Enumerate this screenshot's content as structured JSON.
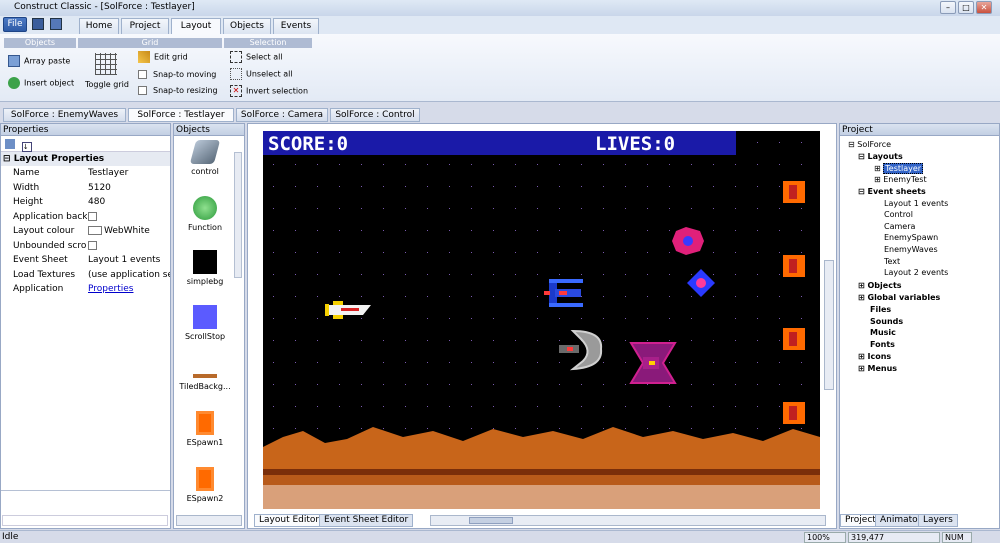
{
  "app": {
    "title": "Construct Classic - [SolForce : Testlayer]"
  },
  "ribbon": {
    "file_label": "File",
    "tabs": [
      {
        "label": "Home"
      },
      {
        "label": "Project"
      },
      {
        "label": "Layout"
      },
      {
        "label": "Objects"
      },
      {
        "label": "Events"
      }
    ],
    "groups": {
      "objects": "Objects",
      "grid": "Grid",
      "selection": "Selection"
    },
    "array_paste": "Array paste",
    "insert_object": "Insert object",
    "toggle_grid": "Toggle grid",
    "edit_grid": "Edit grid",
    "snap_moving": "Snap-to moving",
    "snap_resizing": "Snap-to resizing",
    "select_all": "Select all",
    "unselect_all": "Unselect all",
    "invert_selection": "Invert selection"
  },
  "doc_tabs": [
    {
      "label": "SolForce : EnemyWaves"
    },
    {
      "label": "SolForce : Testlayer"
    },
    {
      "label": "SolForce : Camera"
    },
    {
      "label": "SolForce : Control"
    }
  ],
  "properties": {
    "title": "Properties",
    "section": "Layout Properties",
    "rows": [
      {
        "key": "Name",
        "value": "Testlayer"
      },
      {
        "key": "Width",
        "value": "5120"
      },
      {
        "key": "Height",
        "value": "480"
      },
      {
        "key": "Application backgr",
        "value": ""
      },
      {
        "key": "Layout colour",
        "value": "WebWhite"
      },
      {
        "key": "Unbounded scrolli",
        "value": ""
      },
      {
        "key": "Event Sheet",
        "value": "Layout 1 events"
      },
      {
        "key": "Load Textures",
        "value": "(use application sett"
      },
      {
        "key": "Application",
        "value": "Properties"
      }
    ],
    "colors": {
      "link": "#0000cc"
    }
  },
  "objects_panel": {
    "title": "Objects",
    "items": [
      {
        "label": "control",
        "icon": "gamepad-icon",
        "color": "#5a6a7a"
      },
      {
        "label": "Function",
        "icon": "function-icon",
        "color": "#2b9a3a"
      },
      {
        "label": "simplebg",
        "icon": "black-square-icon",
        "color": "#000000"
      },
      {
        "label": "ScrollStop",
        "icon": "blue-square-icon",
        "color": "#5b5bff"
      },
      {
        "label": "TiledBackg...",
        "icon": "tiled-strip-icon",
        "color": "#b86a2a"
      },
      {
        "label": "ESpawn1",
        "icon": "spawn-icon",
        "color": "#ff6a00"
      },
      {
        "label": "ESpawn2",
        "icon": "spawn-icon",
        "color": "#ff6a00"
      }
    ]
  },
  "game": {
    "score_text": "SCORE:0",
    "lives_text": "LIVES:0",
    "colors": {
      "hud_bg": "#1a1aa8",
      "sky": "#000000",
      "ground": "#c8651a",
      "ground_dark": "#7a2e0a",
      "floor": "#d9a07a"
    }
  },
  "editor_tabs": [
    {
      "label": "Layout Editor"
    },
    {
      "label": "Event Sheet Editor"
    }
  ],
  "project": {
    "title": "Project",
    "root": "SolForce",
    "layouts_label": "Layouts",
    "layouts": [
      "Testlayer",
      "EnemyTest"
    ],
    "event_sheets_label": "Event sheets",
    "event_sheets": [
      "Layout 1 events",
      "Control",
      "Camera",
      "EnemySpawn",
      "EnemyWaves",
      "Text",
      "Layout 2 events"
    ],
    "folders": [
      "Objects",
      "Global variables",
      "Files",
      "Sounds",
      "Music",
      "Fonts",
      "Icons",
      "Menus"
    ],
    "bottom_tabs": [
      {
        "label": "Project"
      },
      {
        "label": "Animator"
      },
      {
        "label": "Layers"
      }
    ]
  },
  "status": {
    "text": "Idle",
    "zoom": "100%",
    "coords": "319,477",
    "num": "NUM"
  }
}
